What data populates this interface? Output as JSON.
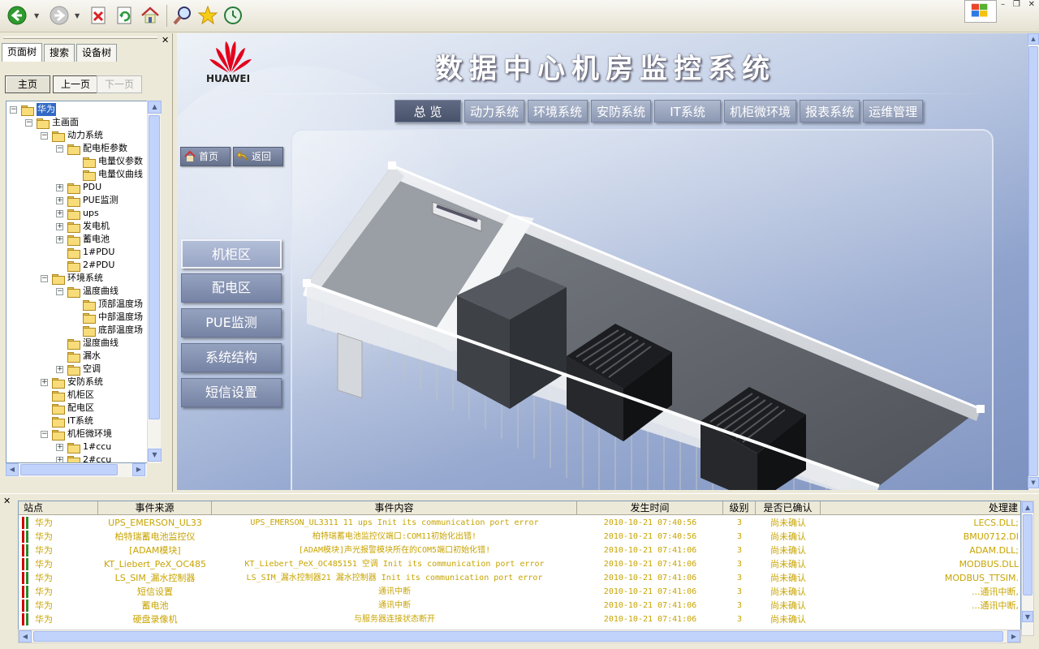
{
  "toolbar": {
    "buttons": [
      "back-icon",
      "forward-icon",
      "stop-icon",
      "refresh-icon",
      "home-icon",
      "search-icon",
      "favorites-icon",
      "history-icon"
    ]
  },
  "left_panel": {
    "tabs": [
      "页面树",
      "搜索",
      "设备树"
    ],
    "nav": {
      "home": "主页",
      "prev": "上一页",
      "next": "下一页"
    },
    "tree": [
      {
        "label": "华为",
        "level": 0,
        "exp": "−",
        "selected": true
      },
      {
        "label": "主画面",
        "level": 1,
        "exp": "−"
      },
      {
        "label": "动力系统",
        "level": 2,
        "exp": "−"
      },
      {
        "label": "配电柜参数",
        "level": 3,
        "exp": "−"
      },
      {
        "label": "电量仪参数",
        "level": 4,
        "exp": ""
      },
      {
        "label": "电量仪曲线",
        "level": 4,
        "exp": ""
      },
      {
        "label": "PDU",
        "level": 3,
        "exp": "+"
      },
      {
        "label": "PUE监测",
        "level": 3,
        "exp": "+"
      },
      {
        "label": "ups",
        "level": 3,
        "exp": "+"
      },
      {
        "label": "发电机",
        "level": 3,
        "exp": "+"
      },
      {
        "label": "蓄电池",
        "level": 3,
        "exp": "+"
      },
      {
        "label": "1#PDU",
        "level": 3,
        "exp": ""
      },
      {
        "label": "2#PDU",
        "level": 3,
        "exp": ""
      },
      {
        "label": "环境系统",
        "level": 2,
        "exp": "−"
      },
      {
        "label": "温度曲线",
        "level": 3,
        "exp": "−"
      },
      {
        "label": "顶部温度场",
        "level": 4,
        "exp": ""
      },
      {
        "label": "中部温度场",
        "level": 4,
        "exp": ""
      },
      {
        "label": "底部温度场",
        "level": 4,
        "exp": ""
      },
      {
        "label": "湿度曲线",
        "level": 3,
        "exp": ""
      },
      {
        "label": "漏水",
        "level": 3,
        "exp": ""
      },
      {
        "label": "空调",
        "level": 3,
        "exp": "+"
      },
      {
        "label": "安防系统",
        "level": 2,
        "exp": "+"
      },
      {
        "label": "机柜区",
        "level": 2,
        "exp": ""
      },
      {
        "label": "配电区",
        "level": 2,
        "exp": ""
      },
      {
        "label": "IT系统",
        "level": 2,
        "exp": ""
      },
      {
        "label": "机柜微环境",
        "level": 2,
        "exp": "−"
      },
      {
        "label": "1#ccu",
        "level": 3,
        "exp": "+"
      },
      {
        "label": "2#ccu",
        "level": 3,
        "exp": "+"
      }
    ]
  },
  "header": {
    "logo_text": "HUAWEI",
    "title": "数据中心机房监控系统"
  },
  "menu": [
    "总 览",
    "动力系统",
    "环境系统",
    "安防系统",
    "IT系统",
    "机柜微环境",
    "报表系统",
    "运维管理"
  ],
  "quicknav": {
    "home": "首页",
    "back": "返回"
  },
  "side_buttons": [
    "机柜区",
    "配电区",
    "PUE监测",
    "系统结构",
    "短信设置"
  ],
  "events": {
    "columns": [
      "站点",
      "事件来源",
      "事件内容",
      "发生时间",
      "级别",
      "是否已确认",
      "处理建"
    ],
    "rows": [
      [
        "华为",
        "UPS_EMERSON_UL33",
        "UPS_EMERSON_UL3311 11 ups Init its communication port error",
        "2010-10-21 07:40:56",
        "3",
        "尚未确认",
        "LECS.DLL;"
      ],
      [
        "华为",
        "柏特瑞蓄电池监控仪",
        "柏特瑞蓄电池监控仪端口:COM11初始化出错!",
        "2010-10-21 07:40:56",
        "3",
        "尚未确认",
        "BMU0712.DI"
      ],
      [
        "华为",
        "[ADAM模块]",
        "[ADAM模块]声光报警模块所在的COM5端口初始化错!",
        "2010-10-21 07:41:06",
        "3",
        "尚未确认",
        "ADAM.DLL;"
      ],
      [
        "华为",
        "KT_Liebert_PeX_OC485",
        "KT_Liebert_PeX_OC485151 空调 Init its communication port error",
        "2010-10-21 07:41:06",
        "3",
        "尚未确认",
        "MODBUS.DLL"
      ],
      [
        "华为",
        "LS_SIM_漏水控制器",
        "LS_SIM_漏水控制器21 漏水控制器 Init its communication port error",
        "2010-10-21 07:41:06",
        "3",
        "尚未确认",
        "MODBUS_TTSIM."
      ],
      [
        "华为",
        "短信设置",
        "通讯中断",
        "2010-10-21 07:41:06",
        "3",
        "尚未确认",
        "...通讯中断,"
      ],
      [
        "华为",
        "蓄电池",
        "通讯中断",
        "2010-10-21 07:41:06",
        "3",
        "尚未确认",
        "...通讯中断,"
      ],
      [
        "华为",
        "硬盘录像机",
        "与服务器连接状态断开",
        "2010-10-21 07:41:06",
        "3",
        "尚未确认",
        ""
      ]
    ]
  },
  "colors": {
    "event_text": "#c8a400",
    "menu_active": "#48526a",
    "tree_selected": "#316ac5"
  }
}
